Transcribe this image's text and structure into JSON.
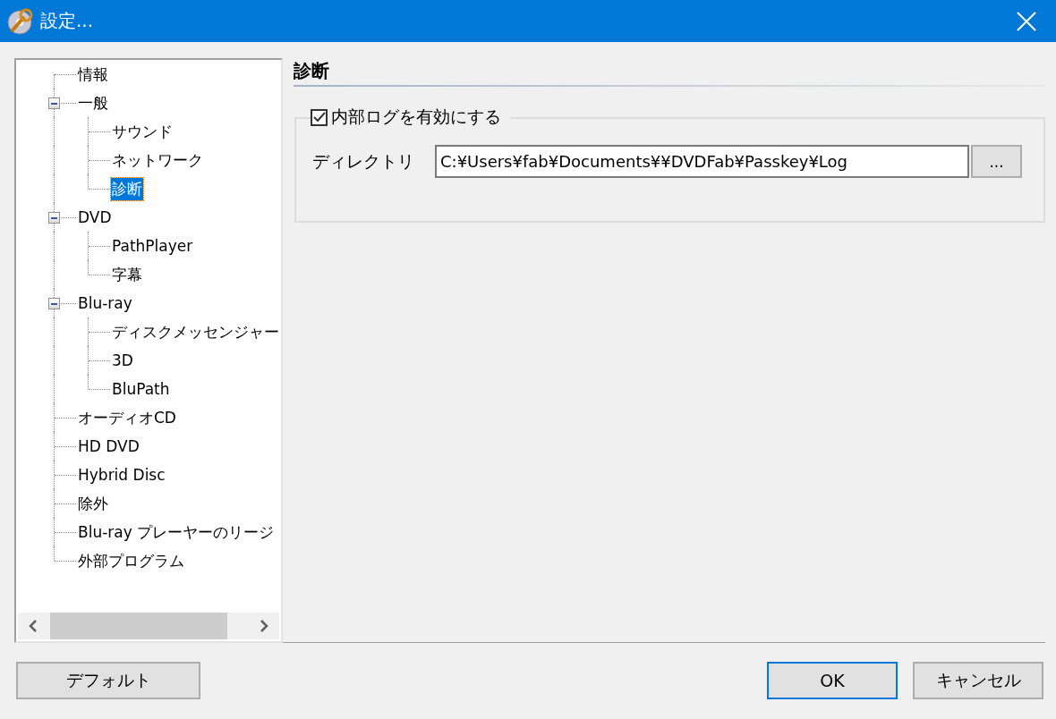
{
  "window": {
    "title": "設定..."
  },
  "tree": [
    {
      "label": "情報",
      "selected": false
    },
    {
      "label": "一般",
      "selected": false,
      "expanded": true,
      "children": [
        {
          "label": "サウンド",
          "selected": false
        },
        {
          "label": "ネットワーク",
          "selected": false
        },
        {
          "label": "診断",
          "selected": true
        }
      ]
    },
    {
      "label": "DVD",
      "selected": false,
      "expanded": true,
      "children": [
        {
          "label": "PathPlayer",
          "selected": false
        },
        {
          "label": "字幕",
          "selected": false
        }
      ]
    },
    {
      "label": "Blu-ray",
      "selected": false,
      "expanded": true,
      "children": [
        {
          "label": "ディスクメッセンジャー",
          "selected": false
        },
        {
          "label": "3D",
          "selected": false
        },
        {
          "label": "BluPath",
          "selected": false
        }
      ]
    },
    {
      "label": "オーディオCD",
      "selected": false
    },
    {
      "label": "HD DVD",
      "selected": false
    },
    {
      "label": "Hybrid Disc",
      "selected": false
    },
    {
      "label": "除外",
      "selected": false
    },
    {
      "label": "Blu-ray プレーヤーのリージ",
      "selected": false
    },
    {
      "label": "外部プログラム",
      "selected": false
    }
  ],
  "panel": {
    "heading": "診断",
    "log_checkbox": {
      "label": "内部ログを有効にする",
      "checked": true
    },
    "directory": {
      "label": "ディレクトリ",
      "value": "C:¥Users¥fab¥Documents¥¥DVDFab¥Passkey¥Log",
      "browse": "..."
    }
  },
  "buttons": [
    {
      "label": "デフォルト",
      "default": false
    },
    {
      "label": "OK",
      "default": true
    },
    {
      "label": "キャンセル",
      "default": false
    }
  ]
}
